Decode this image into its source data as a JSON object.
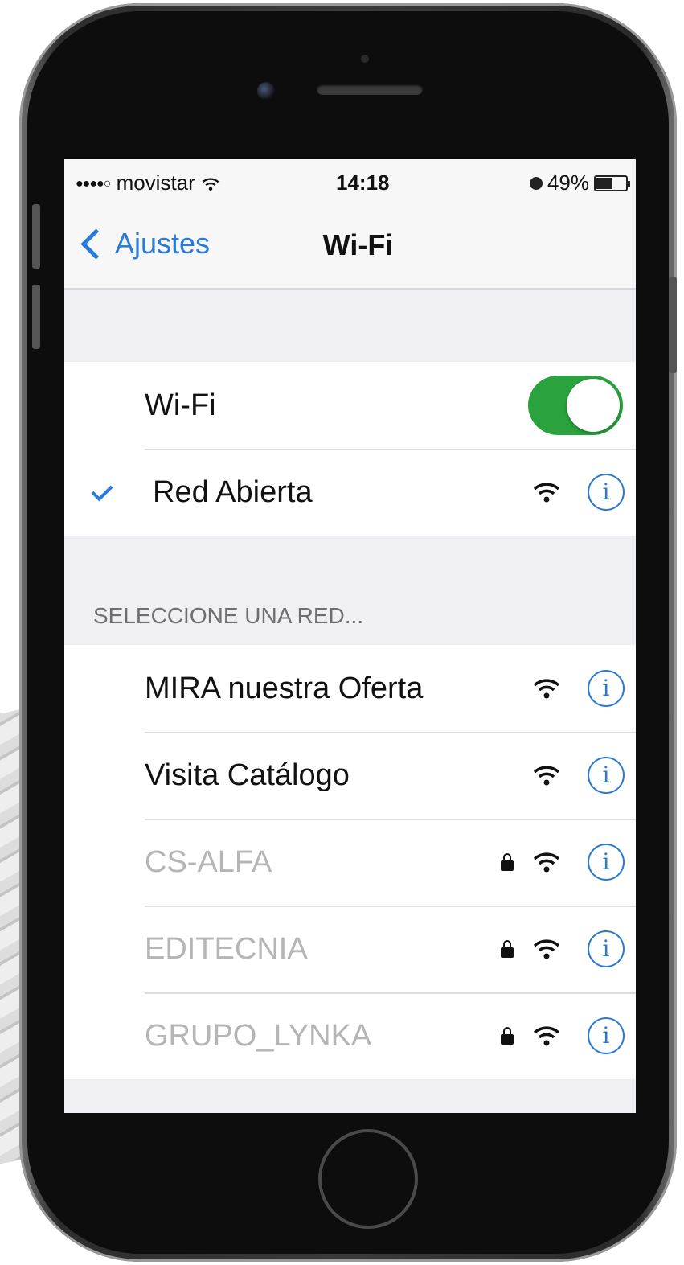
{
  "status_bar": {
    "signal": "●●●●○",
    "carrier": "movistar",
    "time": "14:18",
    "battery_percent": "49%",
    "battery_level": 0.49
  },
  "nav": {
    "back_label": "Ajustes",
    "title": "Wi-Fi"
  },
  "wifi_switch": {
    "label": "Wi-Fi",
    "on": true,
    "color": "#2aa23e"
  },
  "connected_network": {
    "name": "Red Abierta",
    "info_glyph": "i"
  },
  "section_header": "SELECCIONE UNA RED...",
  "networks": [
    {
      "name": "MIRA nuestra Oferta",
      "locked": false,
      "info_glyph": "i"
    },
    {
      "name": "Visita Catálogo",
      "locked": false,
      "info_glyph": "i"
    },
    {
      "name": "CS-ALFA",
      "locked": true,
      "info_glyph": "i"
    },
    {
      "name": "EDITECNIA",
      "locked": true,
      "info_glyph": "i"
    },
    {
      "name": "GRUPO_LYNKA",
      "locked": true,
      "info_glyph": "i"
    }
  ],
  "accent_color": "#2a7bd6"
}
